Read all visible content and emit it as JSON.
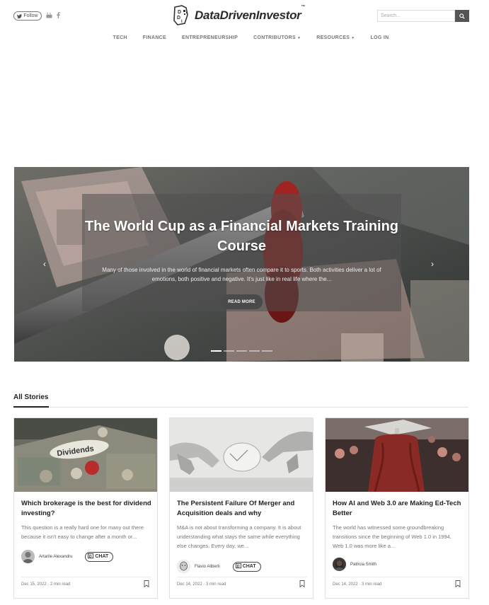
{
  "header": {
    "follow_label": "Follow",
    "logo_text": "DataDrivenInvestor",
    "logo_tm": "™",
    "search_placeholder": "Search...",
    "icons": [
      "twitter-icon",
      "youtube-icon",
      "facebook-icon",
      "search-icon"
    ]
  },
  "nav": {
    "items": [
      {
        "label": "TECH",
        "dropdown": false
      },
      {
        "label": "FINANCE",
        "dropdown": false
      },
      {
        "label": "ENTREPRENEURSHIP",
        "dropdown": false
      },
      {
        "label": "CONTRIBUTORS",
        "dropdown": true
      },
      {
        "label": "RESOURCES",
        "dropdown": true
      },
      {
        "label": "LOG IN",
        "dropdown": false
      }
    ]
  },
  "hero": {
    "title": "The World Cup as a Financial Markets Training Course",
    "excerpt": "Many of those involved in the world of financial markets often compare it to sports. Both activities deliver a lot of emotions, both positive and negative. It's just like in real life where the...",
    "read_more": "READ MORE",
    "slide_count": 5,
    "active_slide": 1
  },
  "section": {
    "title": "All Stories"
  },
  "cards": [
    {
      "title": "Which brokerage is the best for dividend investing?",
      "excerpt": "This question is a really hard one for many out there because it isn't easy to change after a month or...",
      "author": "Artarile Alexandru",
      "chat_label": "CHAT",
      "show_chat": true,
      "meta": "Dec 15, 2022 · 2 min read"
    },
    {
      "title": "The Persistent Failure Of Merger and Acquisition deals and why",
      "excerpt": "M&A is not about transforming a company. It is about understanding what stays the same while everything else changes. Every day, we...",
      "author": "Flavio Aliberti",
      "chat_label": "CHAT",
      "show_chat": true,
      "meta": "Dec 14, 2022 · 3 min read"
    },
    {
      "title": "How AI and Web 3.0 are Making Ed-Tech Better",
      "excerpt": "The world has witnessed some groundbreaking transitions since the beginning of Web 1.0 in 1994. Web 1.0 was more like a...",
      "author": "Patricia Smith",
      "chat_label": "",
      "show_chat": false,
      "meta": "Dec 14, 2022 · 3 min read"
    }
  ],
  "colors": {
    "accent_dark": "#555555",
    "text_primary": "#222222",
    "text_muted": "#777777"
  }
}
